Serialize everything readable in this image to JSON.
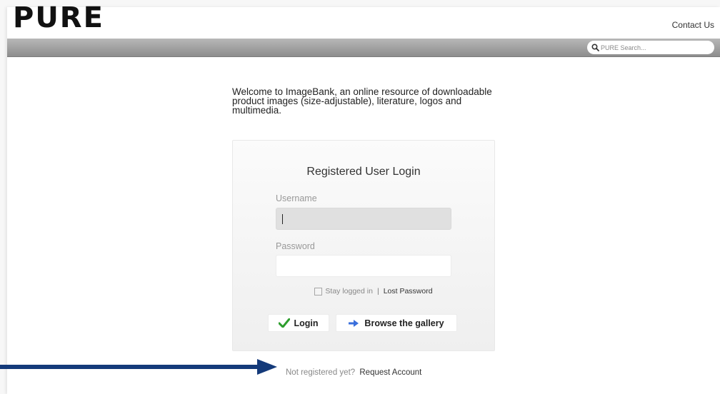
{
  "header": {
    "logo": "PURE",
    "contact_label": "Contact Us"
  },
  "navbar": {
    "search_placeholder": "PURE Search..."
  },
  "main": {
    "welcome_text": "Welcome to ImageBank, an online resource of downloadable product images (size-adjustable), literature, logos and multimedia."
  },
  "login": {
    "title": "Registered User Login",
    "username_label": "Username",
    "username_value": "",
    "password_label": "Password",
    "password_value": "",
    "stay_logged_in_label": "Stay logged in",
    "stay_logged_in_checked": false,
    "separator": "|",
    "lost_password_label": "Lost Password",
    "login_button_label": "Login",
    "browse_button_label": "Browse the gallery"
  },
  "footer": {
    "not_registered_text": "Not registered yet?",
    "request_account_label": "Request Account"
  },
  "colors": {
    "navbar": "#9e9e9e",
    "check_icon": "#2e9e2e",
    "arrow_icon": "#3a6fdc",
    "annotation_arrow": "#143a7a"
  }
}
